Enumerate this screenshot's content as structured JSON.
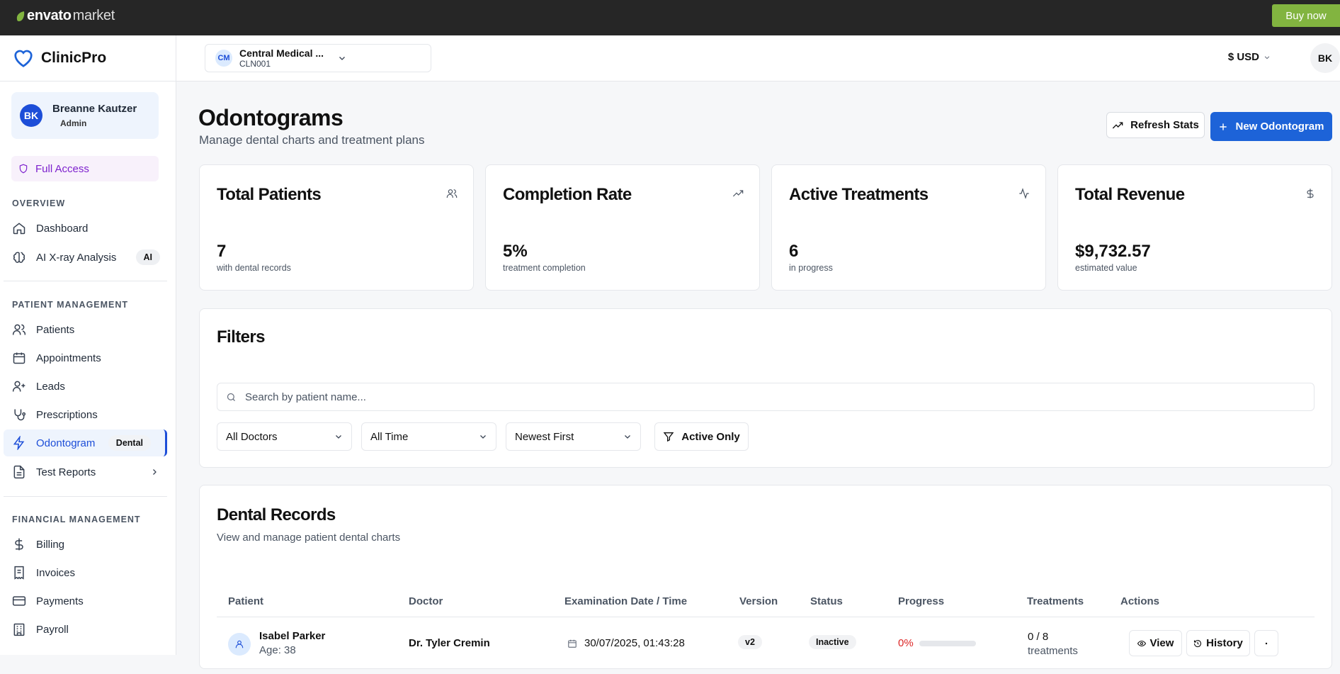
{
  "topbar": {
    "brand": "envato",
    "brand_suffix": "market",
    "buy_label": "Buy now"
  },
  "app": {
    "name": "ClinicPro",
    "accent": "#1d63d8"
  },
  "user": {
    "initials": "BK",
    "name": "Breanne Kautzer",
    "role": "Admin"
  },
  "access": {
    "label": "Full Access"
  },
  "nav": {
    "overview_title": "OVERVIEW",
    "overview": [
      {
        "label": "Dashboard",
        "icon": "home-icon"
      },
      {
        "label": "AI X-ray Analysis",
        "icon": "brain-icon",
        "badge": "AI"
      }
    ],
    "patient_title": "PATIENT MANAGEMENT",
    "patient": [
      {
        "label": "Patients",
        "icon": "users-icon"
      },
      {
        "label": "Appointments",
        "icon": "calendar-icon"
      },
      {
        "label": "Leads",
        "icon": "user-plus-icon"
      },
      {
        "label": "Prescriptions",
        "icon": "stethoscope-icon"
      },
      {
        "label": "Odontogram",
        "icon": "zap-icon",
        "badge": "Dental",
        "active": true
      },
      {
        "label": "Test Reports",
        "icon": "file-text-icon"
      }
    ],
    "financial_title": "FINANCIAL MANAGEMENT",
    "financial": [
      {
        "label": "Billing",
        "icon": "dollar-icon"
      },
      {
        "label": "Invoices",
        "icon": "receipt-icon"
      },
      {
        "label": "Payments",
        "icon": "credit-card-icon"
      },
      {
        "label": "Payroll",
        "icon": "building-icon"
      }
    ]
  },
  "header": {
    "clinic_initials": "CM",
    "clinic_name": "Central Medical ...",
    "clinic_code": "CLN001",
    "currency": "$ USD",
    "user_initials": "BK"
  },
  "page": {
    "title": "Odontograms",
    "subtitle": "Manage dental charts and treatment plans",
    "refresh_label": "Refresh Stats",
    "new_label": "New Odontogram"
  },
  "stats": [
    {
      "title": "Total Patients",
      "value": "7",
      "label": "with dental records",
      "icon": "users-icon"
    },
    {
      "title": "Completion Rate",
      "value": "5%",
      "label": "treatment completion",
      "icon": "trending-up-icon"
    },
    {
      "title": "Active Treatments",
      "value": "6",
      "label": "in progress",
      "icon": "activity-icon"
    },
    {
      "title": "Total Revenue",
      "value": "$9,732.57",
      "label": "estimated value",
      "icon": "dollar-icon"
    }
  ],
  "filters": {
    "title": "Filters",
    "search_placeholder": "Search by patient name...",
    "doctor": "All Doctors",
    "time": "All Time",
    "sort": "Newest First",
    "active_label": "Active Only"
  },
  "records": {
    "title": "Dental Records",
    "subtitle": "View and manage patient dental charts",
    "columns": [
      "Patient",
      "Doctor",
      "Examination Date / Time",
      "Version",
      "Status",
      "Progress",
      "Treatments",
      "Actions"
    ],
    "rows": [
      {
        "patient": "Isabel Parker",
        "age": "Age: 38",
        "doctor": "Dr. Tyler Cremin",
        "date": "30/07/2025, 01:43:28",
        "version": "v2",
        "status": "Inactive",
        "progress": "0%",
        "progress_value": 0,
        "treatments": "0 / 8",
        "treatments_unit": "treatments"
      }
    ],
    "view_label": "View",
    "history_label": "History"
  }
}
